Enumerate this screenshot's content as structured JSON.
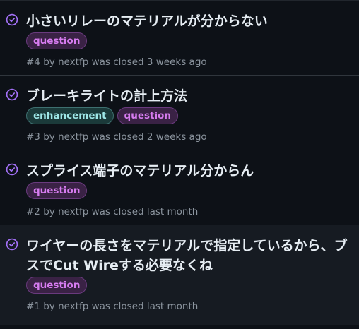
{
  "colors": {
    "background": "#0d1117",
    "closed_icon": "#a371f7",
    "question_label": "#d77cf0",
    "enhancement_label": "#9ee7e7",
    "meta_text": "#8b949e"
  },
  "issues": [
    {
      "title": "小さいリレーのマテリアルが分からない",
      "labels": [
        "question"
      ],
      "number": "#4",
      "by": "by",
      "author": "nextfp",
      "closed_text": "was closed",
      "time": "3 weeks ago",
      "icon": "issue-closed-icon"
    },
    {
      "title": "ブレーキライトの計上方法",
      "labels": [
        "enhancement",
        "question"
      ],
      "number": "#3",
      "by": "by",
      "author": "nextfp",
      "closed_text": "was closed",
      "time": "2 weeks ago",
      "icon": "issue-closed-icon"
    },
    {
      "title": "スプライス端子のマテリアル分からん",
      "labels": [
        "question"
      ],
      "number": "#2",
      "by": "by",
      "author": "nextfp",
      "closed_text": "was closed",
      "time": "last month",
      "icon": "issue-closed-icon"
    },
    {
      "title": "ワイヤーの長さをマテリアルで指定しているから、ブスでCut Wireする必要なくね",
      "labels": [
        "question"
      ],
      "number": "#1",
      "by": "by",
      "author": "nextfp",
      "closed_text": "was closed",
      "time": "last month",
      "icon": "issue-closed-icon"
    }
  ]
}
